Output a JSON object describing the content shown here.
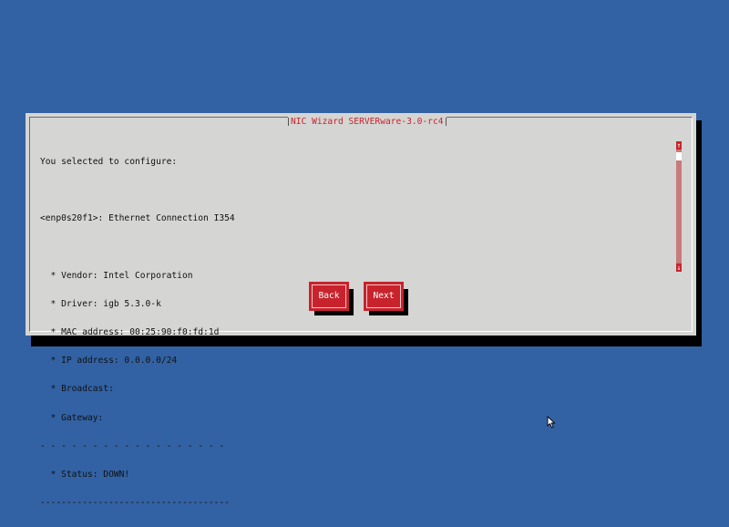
{
  "dialog": {
    "title": "NIC Wizard SERVERware-3.0-rc4",
    "lines": [
      "You selected to configure:",
      "",
      "<enp0s20f1>: Ethernet Connection I354",
      "",
      "  * Vendor: Intel Corporation",
      "  * Driver: igb 5.3.0-k",
      "  * MAC address: 00:25:90:f0:fd:1d",
      "  * IP address: 0.0.0.0/24",
      "  * Broadcast:",
      "  * Gateway:",
      "- - - - - - - - - - - - - - - - - -",
      "  * Status: DOWN!",
      "------------------------------------"
    ],
    "buttons": {
      "back": "Back",
      "next": "Next"
    },
    "scroll_up_glyph": "↑",
    "scroll_down_glyph": "↓"
  },
  "colors": {
    "background": "#3262a3",
    "dialog": "#d5d5d3",
    "accent": "#c8232c"
  },
  "icons": {
    "cursor": "mouse-pointer-icon"
  }
}
